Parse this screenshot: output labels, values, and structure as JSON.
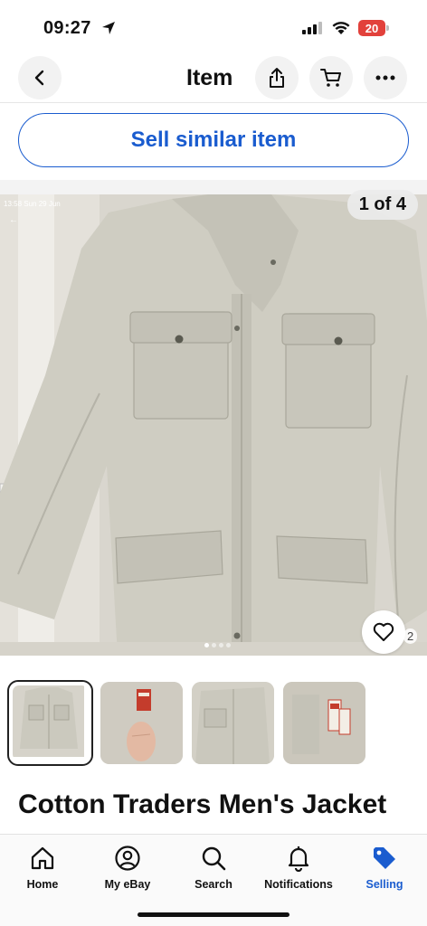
{
  "status_bar": {
    "time": "09:27",
    "battery": "20",
    "location_icon": "location-arrow-icon",
    "signal_icon": "cellular-signal-icon",
    "wifi_icon": "wifi-icon"
  },
  "header": {
    "title": "Item",
    "back_icon": "chevron-left-icon",
    "share_icon": "share-icon",
    "cart_icon": "cart-icon",
    "more_icon": "ellipsis-icon"
  },
  "sell_similar": {
    "label": "Sell similar item"
  },
  "gallery": {
    "counter": "1 of 4",
    "inner_timestamp": "13:58  Sun 29 Jun",
    "current_index": 1,
    "total": 4,
    "watch_count": "2",
    "watch_icon": "heart-icon"
  },
  "thumbnails": [
    {
      "name": "jacket-front"
    },
    {
      "name": "jacket-hand-tag"
    },
    {
      "name": "jacket-detail"
    },
    {
      "name": "jacket-labels"
    }
  ],
  "item": {
    "title": "Cotton Traders Men's Jacket"
  },
  "tab_bar": {
    "tabs": [
      {
        "label": "Home",
        "icon": "home-icon"
      },
      {
        "label": "My eBay",
        "icon": "profile-icon"
      },
      {
        "label": "Search",
        "icon": "search-icon"
      },
      {
        "label": "Notifications",
        "icon": "bell-icon"
      },
      {
        "label": "Selling",
        "icon": "tag-icon",
        "active": true
      }
    ]
  },
  "colors": {
    "accent": "#1a5ccf",
    "battery_low": "#e2413b",
    "jacket": "#cdcbc0"
  }
}
